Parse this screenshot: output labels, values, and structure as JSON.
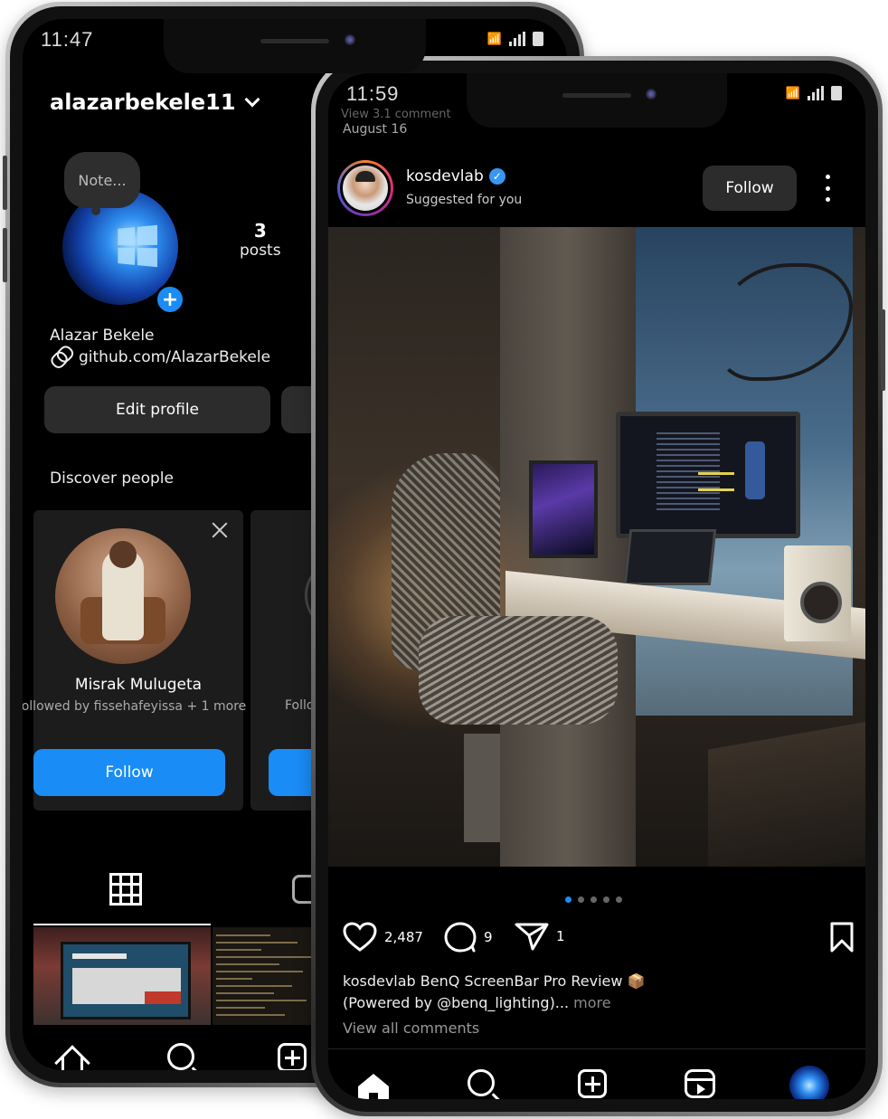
{
  "left_phone": {
    "status": {
      "time": "11:47"
    },
    "profile": {
      "username": "alazarbekele11",
      "note_label": "Note...",
      "posts_count": "3",
      "posts_label": "posts",
      "display_name": "Alazar Bekele",
      "link": "github.com/AlazarBekele",
      "edit_profile_label": "Edit profile"
    },
    "discover": {
      "title": "Discover people",
      "cards": [
        {
          "name": "Misrak Mulugeta",
          "subtitle": "ollowed by fissehafeyissa + 1 more",
          "follow_label": "Follow"
        },
        {
          "subtitle": "Follo"
        }
      ]
    },
    "nav": {
      "items": [
        "home-icon",
        "search-icon",
        "create-icon"
      ]
    }
  },
  "right_phone": {
    "status": {
      "time": "11:59"
    },
    "faded_text": "View 3.1 comment",
    "date": "August 16",
    "post": {
      "username": "kosdevlab",
      "verified": true,
      "suggested_label": "Suggested for you",
      "follow_label": "Follow",
      "carousel": {
        "count": 5,
        "active_index": 0
      },
      "likes": "2,487",
      "comments": "9",
      "shares": "1",
      "caption_user": "kosdevlab",
      "caption_text": " BenQ ScreenBar Pro Review 📦",
      "caption_line2": "(Powered by @benq_lighting)...",
      "more_label": "more",
      "view_comments": "View all comments"
    },
    "nav": {
      "items": [
        "home-icon",
        "search-icon",
        "create-icon",
        "reels-icon",
        "profile-avatar"
      ]
    }
  },
  "colors": {
    "accent": "#1a8cf6",
    "verified": "#3897f0",
    "background": "#000000"
  }
}
